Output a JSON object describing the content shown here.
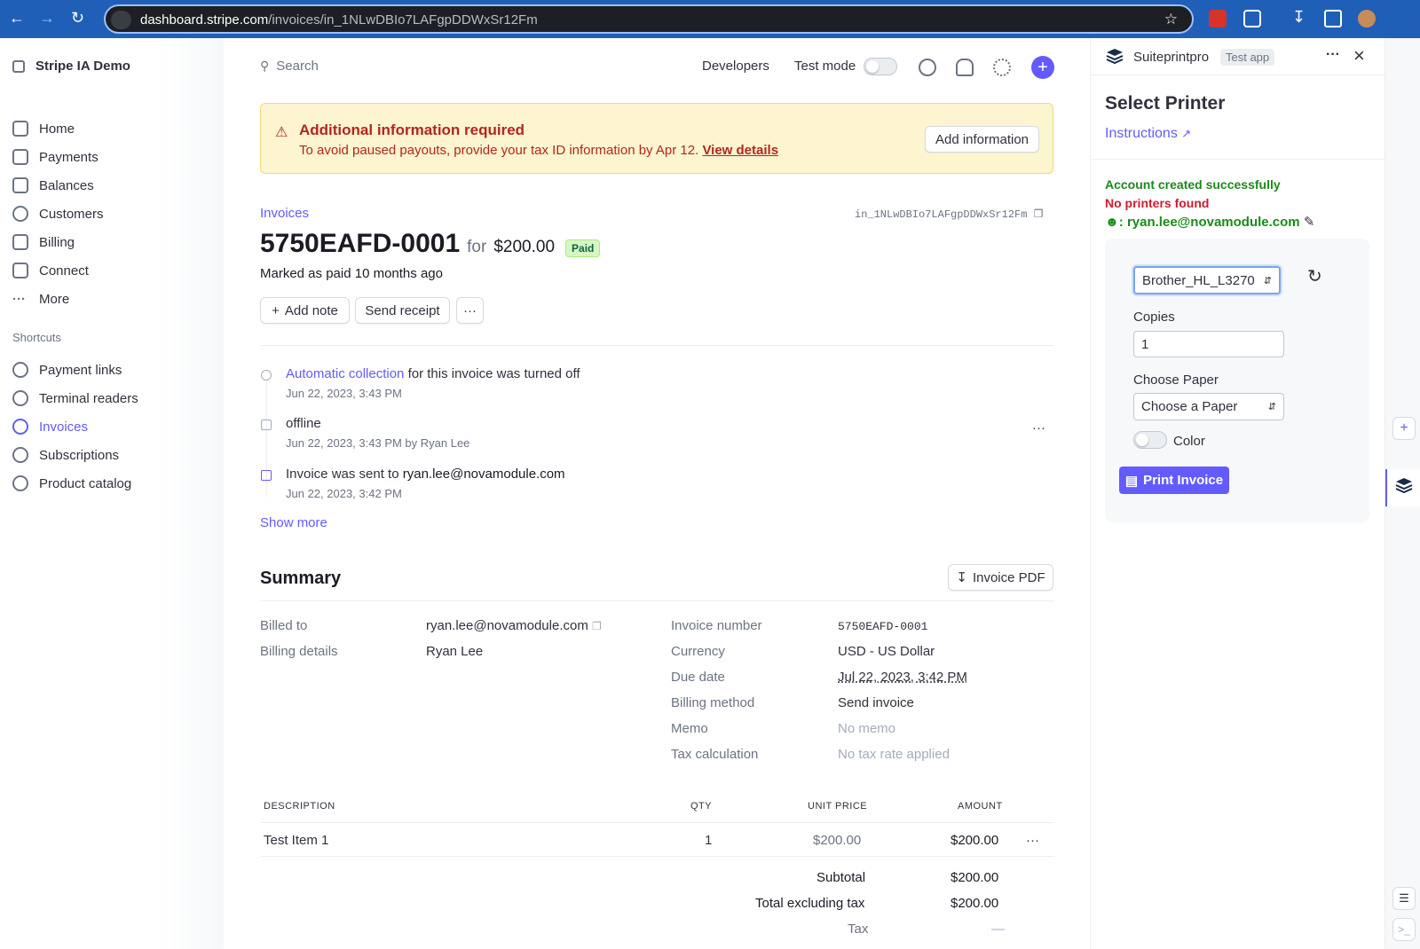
{
  "browser": {
    "url_host": "dashboard.stripe.com",
    "url_path": "/invoices/in_1NLwDBIo7LAFgpDDWxSr12Fm"
  },
  "sidebar": {
    "account": "Stripe IA Demo",
    "items": [
      {
        "label": "Home",
        "icon": "home-icon"
      },
      {
        "label": "Payments",
        "icon": "payments-icon"
      },
      {
        "label": "Balances",
        "icon": "balances-icon"
      },
      {
        "label": "Customers",
        "icon": "customers-icon"
      },
      {
        "label": "Billing",
        "icon": "billing-icon"
      },
      {
        "label": "Connect",
        "icon": "connect-icon"
      },
      {
        "label": "More",
        "icon": "more-icon"
      }
    ],
    "shortcuts_title": "Shortcuts",
    "shortcuts": [
      {
        "label": "Payment links"
      },
      {
        "label": "Terminal readers"
      },
      {
        "label": "Invoices",
        "active": true
      },
      {
        "label": "Subscriptions"
      },
      {
        "label": "Product catalog"
      }
    ]
  },
  "topbar": {
    "search_placeholder": "Search",
    "developers": "Developers",
    "test_mode": "Test mode"
  },
  "banner": {
    "title": "Additional information required",
    "text": "To avoid paused payouts, provide your tax ID information by Apr 12.",
    "link": "View details",
    "button": "Add information"
  },
  "invoice": {
    "breadcrumb": "Invoices",
    "id": "in_1NLwDBIo7LAFgpDDWxSr12Fm",
    "number": "5750EAFD-0001",
    "for": "for",
    "amount": "$200.00",
    "status": "Paid",
    "marked_prefix": "Marked as paid",
    "marked_time": "10 months ago",
    "actions": {
      "add_note": "Add note",
      "send_receipt": "Send receipt"
    }
  },
  "timeline": [
    {
      "link": "Automatic collection",
      "text": " for this invoice was turned off",
      "sub": "Jun 22, 2023, 3:43 PM"
    },
    {
      "text": "offline",
      "sub": "Jun 22, 2023, 3:43 PM by Ryan Lee"
    },
    {
      "text": "Invoice was sent to ",
      "strong": "ryan.lee@novamodule.com",
      "sub": "Jun 22, 2023, 3:42 PM"
    }
  ],
  "show_more": "Show more",
  "summary": {
    "title": "Summary",
    "pdf_button": "Invoice PDF",
    "billed_to_label": "Billed to",
    "billed_to": "ryan.lee@novamodule.com",
    "billing_details_label": "Billing details",
    "billing_details": "Ryan Lee",
    "fields": [
      {
        "label": "Invoice number",
        "value": "5750EAFD-0001"
      },
      {
        "label": "Currency",
        "value": "USD - US Dollar"
      },
      {
        "label": "Due date",
        "value": "Jul 22, 2023, 3:42 PM"
      },
      {
        "label": "Billing method",
        "value": "Send invoice"
      },
      {
        "label": "Memo",
        "value": "No memo"
      },
      {
        "label": "Tax calculation",
        "value": "No tax rate applied"
      }
    ]
  },
  "line_items": {
    "headers": {
      "description": "DESCRIPTION",
      "qty": "QTY",
      "unit_price": "UNIT PRICE",
      "amount": "AMOUNT"
    },
    "rows": [
      {
        "description": "Test Item 1",
        "qty": "1",
        "unit_price": "$200.00",
        "amount": "$200.00"
      }
    ],
    "subtotal_label": "Subtotal",
    "subtotal": "$200.00",
    "total_ex_tax_label": "Total excluding tax",
    "total_ex_tax": "$200.00",
    "tax_label": "Tax",
    "tax": "—"
  },
  "app_panel": {
    "app_name": "Suiteprintpro",
    "app_badge": "Test app",
    "heading": "Select Printer",
    "instructions": "Instructions",
    "status_ok": "Account created successfully",
    "status_err": "No printers found",
    "user": ": ryan.lee@novamodule.com",
    "printer": "Brother_HL_L3270",
    "copies_label": "Copies",
    "copies_value": "1",
    "paper_label": "Choose Paper",
    "paper_value": "Choose a Paper",
    "color_label": "Color",
    "print_button": "Print Invoice"
  },
  "colors": {
    "accent": "#635bff",
    "chrome": "#1f5fb8",
    "banner_bg": "#fcf5cf",
    "error": "#d11b2f",
    "success": "#1b8a1b"
  }
}
